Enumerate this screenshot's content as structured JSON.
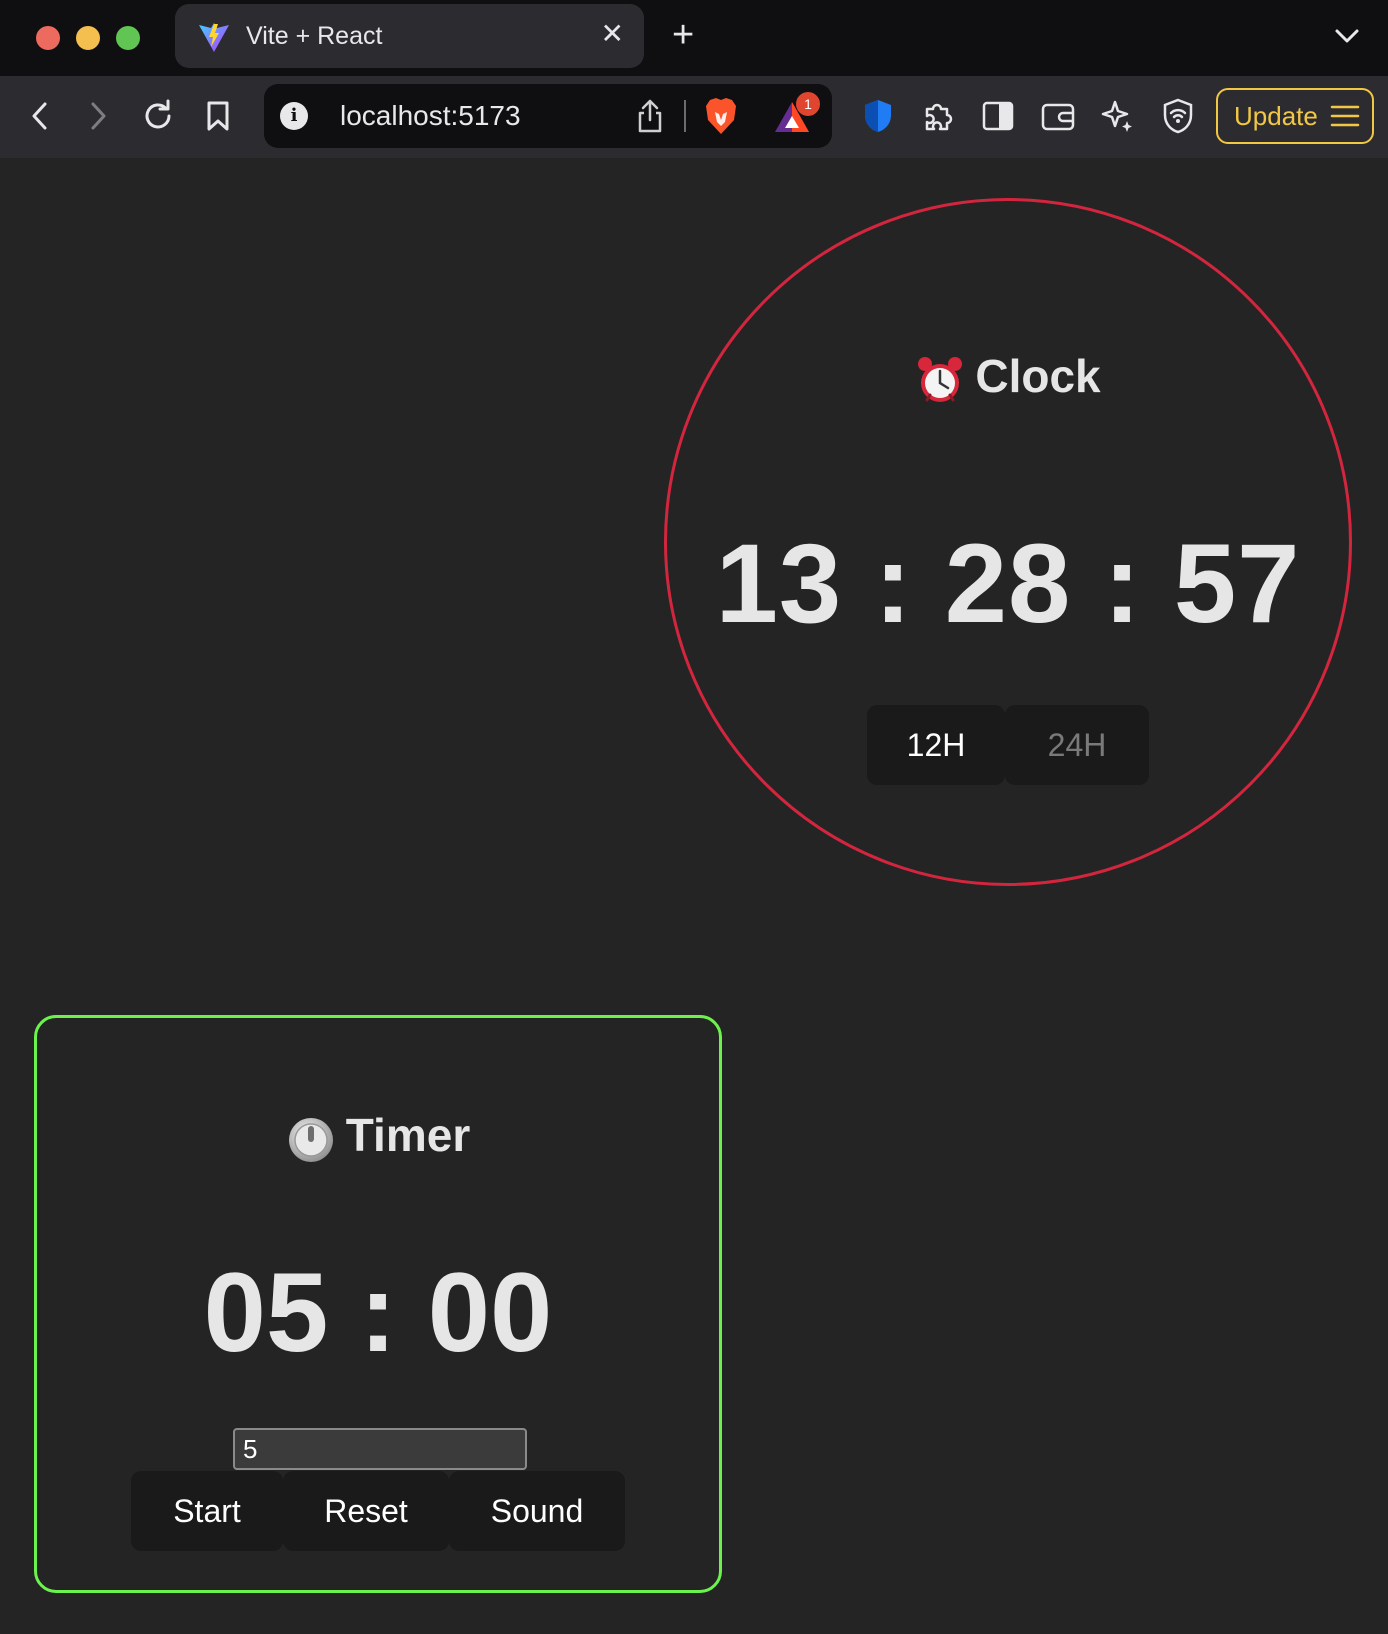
{
  "browser": {
    "tab_title": "Vite + React",
    "url": "localhost:5173",
    "rewards_badge": "1",
    "update_label": "Update"
  },
  "clock": {
    "title": "Clock",
    "time": "13 : 28 : 57",
    "format_12h_label": "12H",
    "format_24h_label": "24H",
    "border_color": "#d3263e"
  },
  "timer": {
    "title": "Timer",
    "time": "05 : 00",
    "minutes_input_value": "5",
    "start_label": "Start",
    "reset_label": "Reset",
    "sound_label": "Sound",
    "border_color": "#6cf24c"
  }
}
